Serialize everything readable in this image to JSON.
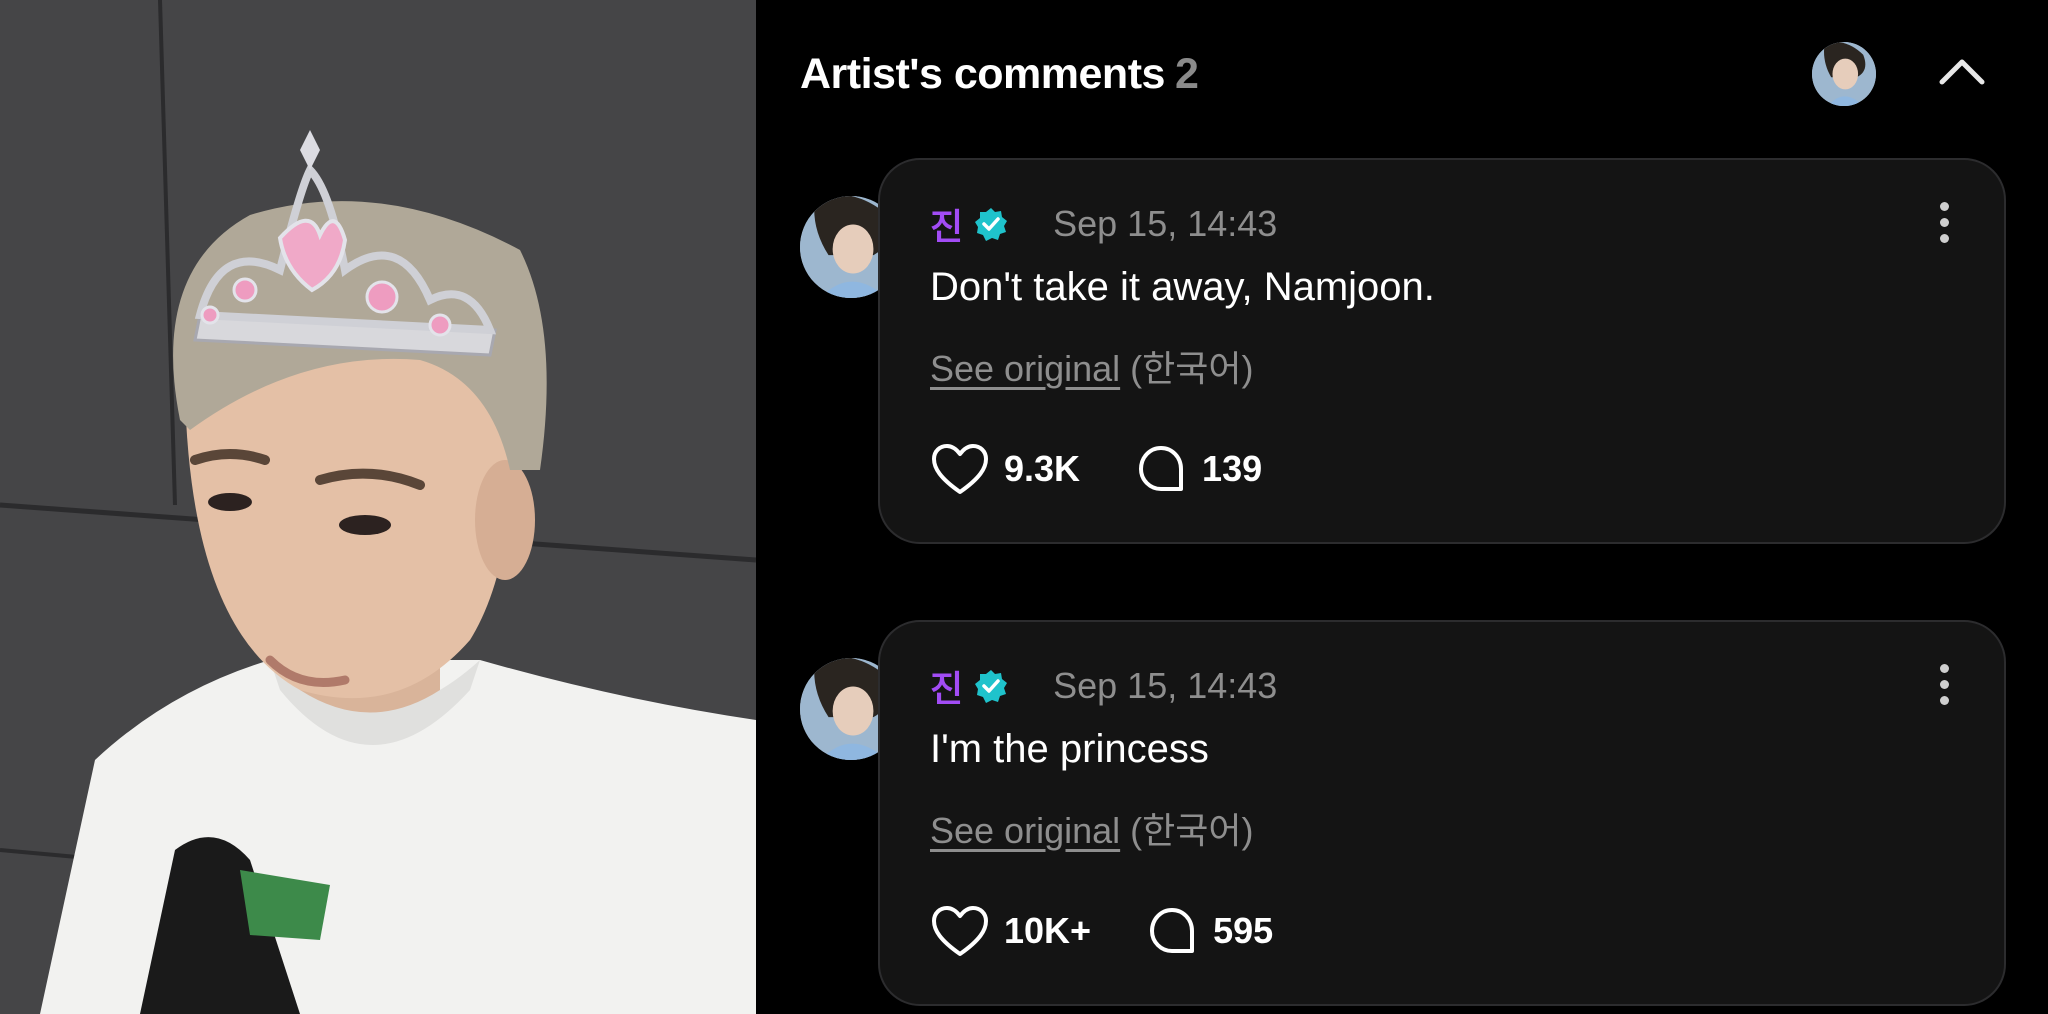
{
  "header": {
    "title": "Artist's comments",
    "count": "2"
  },
  "comments": [
    {
      "author": "진",
      "timestamp": "Sep 15, 14:43",
      "text": "Don't take it away, Namjoon.",
      "see_original": "See original",
      "language": "(한국어)",
      "likes": "9.3K",
      "replies": "139"
    },
    {
      "author": "진",
      "timestamp": "Sep 15, 14:43",
      "text": "I'm the princess",
      "see_original": "See original",
      "language": "(한국어)",
      "likes": "10K+",
      "replies": "595"
    }
  ],
  "icons": {
    "verified": "verified-badge-icon",
    "more": "more-vertical-icon",
    "like": "heart-icon",
    "reply": "speech-bubble-icon",
    "collapse": "chevron-up-icon"
  },
  "colors": {
    "author_name": "#a24cf5",
    "verified_badge": "#1fc3cc",
    "muted_text": "#8e8e8e",
    "card_bg": "#141414"
  }
}
